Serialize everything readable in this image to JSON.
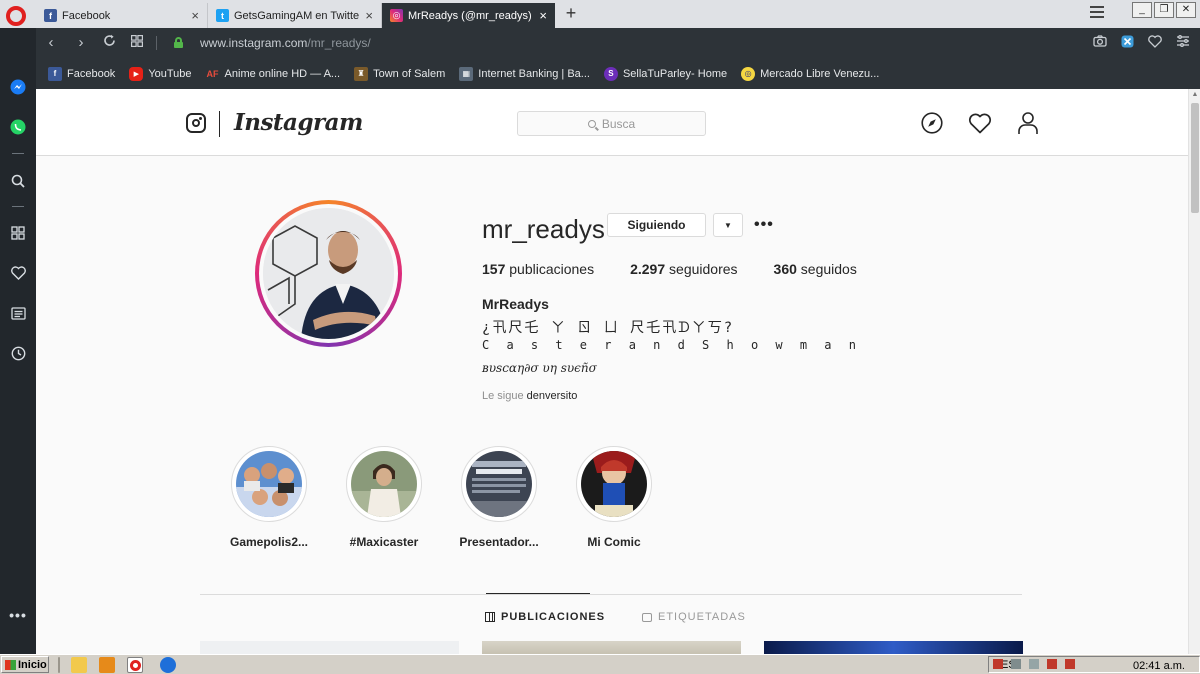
{
  "browser": {
    "tabs": [
      {
        "title": "Facebook",
        "active": false
      },
      {
        "title": "GetsGamingAM en Twitter: \"D",
        "active": false
      },
      {
        "title": "MrReadys (@mr_readys) • Fo",
        "active": true
      }
    ],
    "new_tab": "+",
    "url_host": "www.instagram.com",
    "url_path": "/mr_readys/",
    "bookmarks": [
      {
        "label": "Facebook",
        "color": "#3b5998",
        "glyph": "f"
      },
      {
        "label": "YouTube",
        "color": "#e62117",
        "glyph": "▶"
      },
      {
        "label": "Anime online HD — A...",
        "color": "#c0392b",
        "glyph": "AF"
      },
      {
        "label": "Town of Salem",
        "color": "#7a5a2a",
        "glyph": "♜"
      },
      {
        "label": "Internet Banking | Ba...",
        "color": "#5b6a7a",
        "glyph": "▦"
      },
      {
        "label": "SellaTuParley- Home",
        "color": "#6c2eb9",
        "glyph": "S"
      },
      {
        "label": "Mercado Libre Venezu...",
        "color": "#f5d742",
        "glyph": "◎"
      }
    ]
  },
  "sidebar": {
    "icons": [
      "opera-icon",
      "messenger-icon",
      "whatsapp-icon",
      "search-icon",
      "speed-dial-icon",
      "heart-icon",
      "news-icon",
      "history-icon",
      "more-icon"
    ]
  },
  "instagram": {
    "wordmark": "Instagram",
    "search_placeholder": "Busca",
    "profile": {
      "username": "mr_readys",
      "follow_label": "Siguiendo",
      "caret": "▼",
      "more": "•••",
      "stats": [
        {
          "value": "157",
          "label": "publicaciones"
        },
        {
          "value": "2.297",
          "label": "seguidores"
        },
        {
          "value": "360",
          "label": "seguidos"
        }
      ],
      "full_name": "MrReadys",
      "bio_line1": "¿卂尺乇 ㄚ ㄖ ㄩ 尺乇卂ᗪㄚ丂?",
      "bio_line2": "C a s t e r a n d S h o w m a n",
      "bio_line3": "ʙυѕcαη∂σ υη ѕυєñσ",
      "followed_by_prefix": "Le sigue",
      "followed_by_user": "denversito"
    },
    "highlights": [
      {
        "label": "Gamepolis2..."
      },
      {
        "label": "#Maxicaster"
      },
      {
        "label": "Presentador..."
      },
      {
        "label": "Mi Comic"
      }
    ],
    "tabs": [
      {
        "label": "PUBLICACIONES",
        "active": true
      },
      {
        "label": "ETIQUETADAS",
        "active": false
      }
    ]
  },
  "taskbar": {
    "start_label": "Inicio",
    "language": "ES",
    "time": "02:41 a.m."
  }
}
